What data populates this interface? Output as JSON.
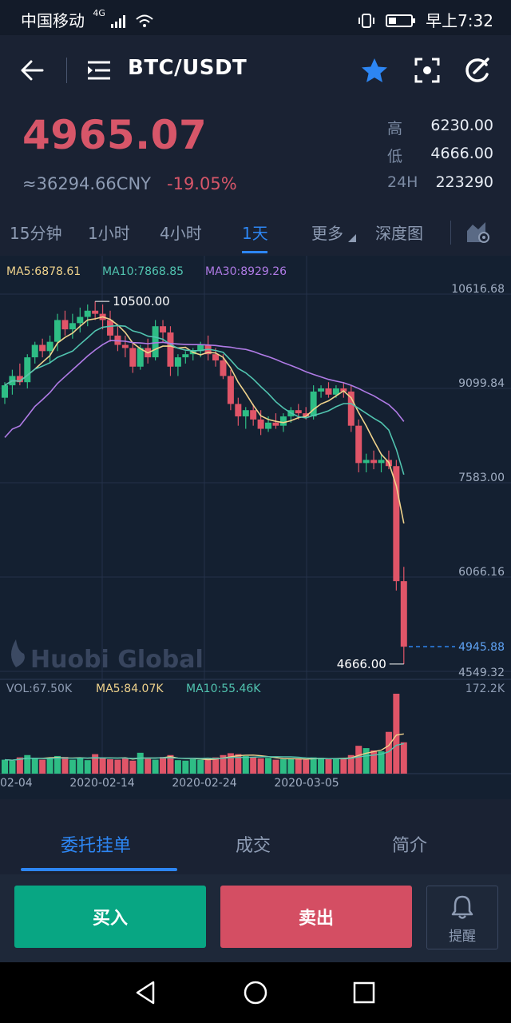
{
  "status_bar": {
    "carrier": "中国移动",
    "network": "4G",
    "time": "早上7:32"
  },
  "header": {
    "pair": "BTC/USDT"
  },
  "ticker": {
    "price": "4965.07",
    "cny": "≈36294.66CNY",
    "change": "-19.05%",
    "stats": [
      {
        "label": "高",
        "value": "6230.00"
      },
      {
        "label": "低",
        "value": "4666.00"
      },
      {
        "label": "24H",
        "value": "223290"
      }
    ]
  },
  "period_tabs": [
    "15分钟",
    "1小时",
    "4小时",
    "1天",
    "更多",
    "深度图"
  ],
  "active_period": "1天",
  "chart_data": {
    "type": "candlestick",
    "indicators": {
      "ma5": "MA5:6878.61",
      "ma10": "MA10:7868.85",
      "ma30": "MA30:8929.26"
    },
    "price_axis": [
      "10616.68",
      "9099.84",
      "7583.00",
      "6066.16",
      "4549.32"
    ],
    "current_price_label": "4945.88",
    "max_label": "10500.00",
    "min_label": "4666.00",
    "watermark": "Huobi Global",
    "volume": {
      "vol": "VOL:67.50K",
      "ma5": "MA5:84.07K",
      "ma10": "MA10:55.46K",
      "max": "172.2K"
    },
    "date_axis": [
      "02-04",
      "2020-02-14",
      "2020-02-24",
      "2020-03-05"
    ],
    "colors": {
      "up": "#2ebd85",
      "down": "#e05568",
      "ma5": "#f0d38c",
      "ma10": "#51c4b0",
      "ma30": "#b07be6"
    },
    "candles": [
      {
        "o": 8950,
        "h": 9200,
        "l": 8850,
        "c": 9150
      },
      {
        "o": 9150,
        "h": 9400,
        "l": 9000,
        "c": 9300
      },
      {
        "o": 9300,
        "h": 9500,
        "l": 9150,
        "c": 9200
      },
      {
        "o": 9200,
        "h": 9650,
        "l": 9100,
        "c": 9600
      },
      {
        "o": 9600,
        "h": 9850,
        "l": 9500,
        "c": 9800
      },
      {
        "o": 9800,
        "h": 9900,
        "l": 9600,
        "c": 9700
      },
      {
        "o": 9700,
        "h": 9950,
        "l": 9500,
        "c": 9850
      },
      {
        "o": 9850,
        "h": 10300,
        "l": 9700,
        "c": 10200
      },
      {
        "o": 10200,
        "h": 10350,
        "l": 9950,
        "c": 10050
      },
      {
        "o": 10050,
        "h": 10300,
        "l": 9900,
        "c": 10150
      },
      {
        "o": 10150,
        "h": 10400,
        "l": 10000,
        "c": 10250
      },
      {
        "o": 10250,
        "h": 10450,
        "l": 10100,
        "c": 10350
      },
      {
        "o": 10350,
        "h": 10500,
        "l": 10200,
        "c": 10300
      },
      {
        "o": 10300,
        "h": 10450,
        "l": 10050,
        "c": 10200
      },
      {
        "o": 10200,
        "h": 10350,
        "l": 9850,
        "c": 9950
      },
      {
        "o": 9950,
        "h": 10100,
        "l": 9700,
        "c": 9800
      },
      {
        "o": 9800,
        "h": 9950,
        "l": 9600,
        "c": 9750
      },
      {
        "o": 9750,
        "h": 9850,
        "l": 9350,
        "c": 9450
      },
      {
        "o": 9450,
        "h": 9800,
        "l": 9400,
        "c": 9750
      },
      {
        "o": 9750,
        "h": 9900,
        "l": 9500,
        "c": 9600
      },
      {
        "o": 9600,
        "h": 10200,
        "l": 9550,
        "c": 10100
      },
      {
        "o": 10100,
        "h": 10200,
        "l": 9850,
        "c": 10000
      },
      {
        "o": 10000,
        "h": 10100,
        "l": 9300,
        "c": 9450
      },
      {
        "o": 9450,
        "h": 9650,
        "l": 9300,
        "c": 9600
      },
      {
        "o": 9600,
        "h": 9700,
        "l": 9500,
        "c": 9650
      },
      {
        "o": 9650,
        "h": 9750,
        "l": 9550,
        "c": 9700
      },
      {
        "o": 9700,
        "h": 9850,
        "l": 9600,
        "c": 9800
      },
      {
        "o": 9800,
        "h": 9950,
        "l": 9550,
        "c": 9650
      },
      {
        "o": 9650,
        "h": 9750,
        "l": 9450,
        "c": 9550
      },
      {
        "o": 9550,
        "h": 9650,
        "l": 9250,
        "c": 9300
      },
      {
        "o": 9300,
        "h": 9400,
        "l": 8750,
        "c": 8850
      },
      {
        "o": 8850,
        "h": 8950,
        "l": 8500,
        "c": 8650
      },
      {
        "o": 8650,
        "h": 8800,
        "l": 8450,
        "c": 8750
      },
      {
        "o": 8750,
        "h": 8850,
        "l": 8500,
        "c": 8600
      },
      {
        "o": 8600,
        "h": 8750,
        "l": 8350,
        "c": 8450
      },
      {
        "o": 8450,
        "h": 8650,
        "l": 8400,
        "c": 8550
      },
      {
        "o": 8550,
        "h": 8700,
        "l": 8450,
        "c": 8500
      },
      {
        "o": 8500,
        "h": 8700,
        "l": 8400,
        "c": 8650
      },
      {
        "o": 8650,
        "h": 8800,
        "l": 8550,
        "c": 8750
      },
      {
        "o": 8750,
        "h": 8850,
        "l": 8600,
        "c": 8700
      },
      {
        "o": 8700,
        "h": 8800,
        "l": 8600,
        "c": 8650
      },
      {
        "o": 8650,
        "h": 9150,
        "l": 8600,
        "c": 9050
      },
      {
        "o": 9050,
        "h": 9150,
        "l": 8950,
        "c": 9100
      },
      {
        "o": 9100,
        "h": 9200,
        "l": 8950,
        "c": 9000
      },
      {
        "o": 9000,
        "h": 9150,
        "l": 8950,
        "c": 9100
      },
      {
        "o": 9100,
        "h": 9200,
        "l": 8950,
        "c": 9050
      },
      {
        "o": 9050,
        "h": 9150,
        "l": 8400,
        "c": 8500
      },
      {
        "o": 8500,
        "h": 8600,
        "l": 7750,
        "c": 7900
      },
      {
        "o": 7900,
        "h": 8050,
        "l": 7750,
        "c": 7950
      },
      {
        "o": 7950,
        "h": 8100,
        "l": 7800,
        "c": 7900
      },
      {
        "o": 7900,
        "h": 8050,
        "l": 7750,
        "c": 7950
      },
      {
        "o": 7950,
        "h": 8100,
        "l": 7800,
        "c": 7850
      },
      {
        "o": 7850,
        "h": 7950,
        "l": 5850,
        "c": 6000
      },
      {
        "o": 6000,
        "h": 6230,
        "l": 4666,
        "c": 4945.88
      }
    ],
    "volumes": [
      30,
      28,
      35,
      40,
      32,
      30,
      34,
      38,
      36,
      30,
      33,
      29,
      42,
      35,
      31,
      30,
      33,
      28,
      45,
      32,
      30,
      36,
      40,
      29,
      28,
      31,
      30,
      33,
      35,
      40,
      44,
      42,
      38,
      36,
      33,
      34,
      30,
      31,
      33,
      32,
      30,
      35,
      34,
      31,
      33,
      32,
      40,
      60,
      55,
      50,
      48,
      90,
      172.2,
      67.5
    ]
  },
  "bottom_tabs": [
    "委托挂单",
    "成交",
    "简介"
  ],
  "actions": {
    "buy": "买入",
    "sell": "卖出",
    "remind": "提醒"
  }
}
